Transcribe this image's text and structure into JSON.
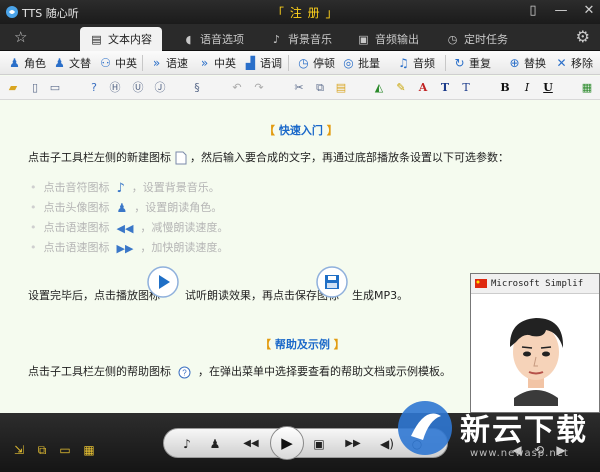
{
  "titlebar": {
    "app_name": "TTS 随心听",
    "register": "「 注 册 」",
    "icons": [
      "tts-logo-icon",
      "restore-icon",
      "minimize-icon",
      "close-icon"
    ]
  },
  "tabs": [
    {
      "label": "文本内容",
      "icon": "document-icon",
      "active": true
    },
    {
      "label": "语音选项",
      "icon": "chat-icon",
      "active": false
    },
    {
      "label": "背景音乐",
      "icon": "music-note-icon",
      "active": false
    },
    {
      "label": "音频输出",
      "icon": "audio-output-icon",
      "active": false
    },
    {
      "label": "定时任务",
      "icon": "timer-icon",
      "active": false
    }
  ],
  "toolbar": {
    "items": [
      {
        "label": "角色",
        "icon": "person-icon"
      },
      {
        "label": "文替",
        "icon": "person-icon"
      },
      {
        "label": "中英",
        "icon": "people-icon"
      },
      {
        "label": "语速",
        "icon": "speed-icon"
      },
      {
        "label": "中英",
        "icon": "speed-icon"
      },
      {
        "label": "语调",
        "icon": "pitch-icon"
      },
      {
        "label": "停顿",
        "icon": "clock-icon"
      },
      {
        "label": "批量",
        "icon": "batch-icon"
      },
      {
        "label": "音频",
        "icon": "audio-icon"
      },
      {
        "label": "重复",
        "icon": "repeat-icon"
      },
      {
        "label": "替换",
        "icon": "replace-icon"
      },
      {
        "label": "移除",
        "icon": "remove-icon"
      }
    ]
  },
  "format_toolbar": {
    "bold": "B",
    "italic": "I",
    "underline": "U",
    "text_a": "A",
    "text_t1": "T",
    "text_t2": "T"
  },
  "content": {
    "quickstart_title": "快速入门",
    "line1_pre": "点击子工具栏左侧的新建图标",
    "line1_post": "，然后输入要合成的文字，再通过底部播放条设置以下可选参数：",
    "options": [
      {
        "pre": "点击音符图标",
        "post": "，设置背景音乐。",
        "icon": "music-note-icon"
      },
      {
        "pre": "点击头像图标",
        "post": "，设置朗读角色。",
        "icon": "person-icon"
      },
      {
        "pre": "点击语速图标",
        "post": "，减慢朗读速度。",
        "icon": "rewind-icon"
      },
      {
        "pre": "点击语速图标",
        "post": "，加快朗读速度。",
        "icon": "fast-forward-icon"
      }
    ],
    "line_done_a": "设置完毕后，点击播放图标",
    "line_done_b": "试听朗读效果，再点击保存图标",
    "line_done_c": "生成MP3。",
    "help_title": "帮助及示例",
    "help_pre": "点击子工具栏左侧的帮助图标",
    "help_post": "，在弹出菜单中选择要查看的帮助文档或示例模板。"
  },
  "avatar_window": {
    "title": "Microsoft Simplif"
  },
  "watermark": {
    "text": "新云下载",
    "url": "www.newasp.net"
  },
  "colors": {
    "accent": "#1a68c9",
    "bracket": "#e29b10",
    "register": "#ffd21c",
    "content_bg": "#f5fbef"
  }
}
